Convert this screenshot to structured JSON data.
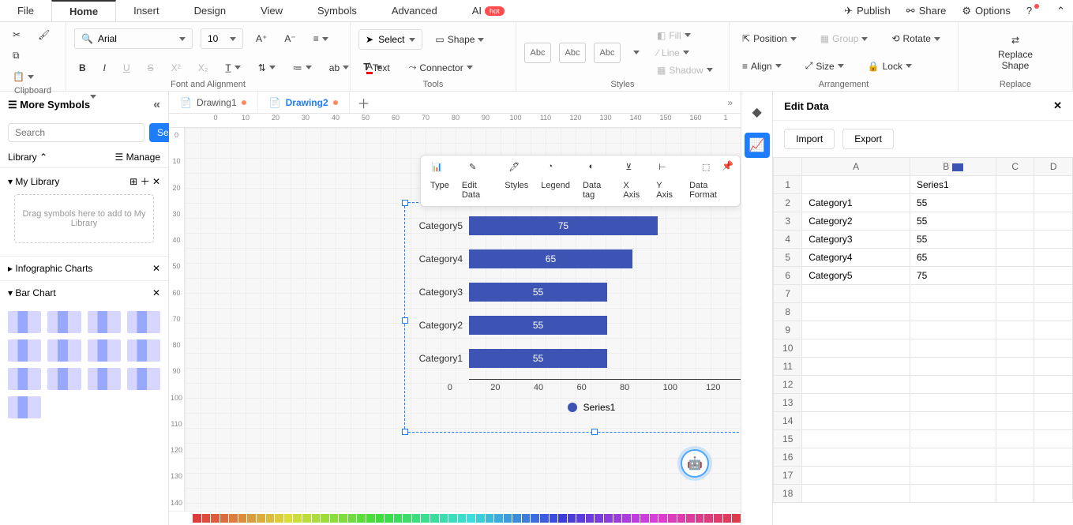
{
  "menu": {
    "file": "File",
    "home": "Home",
    "insert": "Insert",
    "design": "Design",
    "view": "View",
    "symbols": "Symbols",
    "advanced": "Advanced",
    "ai": "AI",
    "hot": "hot",
    "publish": "Publish",
    "share": "Share",
    "options": "Options"
  },
  "ribbon": {
    "clipboard": "Clipboard",
    "font_alignment": "Font and Alignment",
    "tools": "Tools",
    "styles": "Styles",
    "arrangement": "Arrangement",
    "replace": "Replace",
    "font_name": "Arial",
    "font_size": "10",
    "select": "Select",
    "shape": "Shape",
    "text": "Text",
    "connector": "Connector",
    "style_sample": "Abc",
    "fill": "Fill",
    "line": "Line",
    "shadow": "Shadow",
    "position": "Position",
    "align": "Align",
    "group": "Group",
    "size": "Size",
    "rotate": "Rotate",
    "lock": "Lock",
    "replace_shape": "Replace\nShape"
  },
  "left": {
    "more_symbols": "More Symbols",
    "search_ph": "Search",
    "search_btn": "Search",
    "library": "Library",
    "manage": "Manage",
    "my_library": "My Library",
    "drop_hint": "Drag symbols here to add to My Library",
    "infographic": "Infographic Charts",
    "bar_chart": "Bar Chart"
  },
  "docs": {
    "d1": "Drawing1",
    "d2": "Drawing2"
  },
  "float": {
    "type": "Type",
    "edit_data": "Edit Data",
    "styles": "Styles",
    "legend": "Legend",
    "data_tag": "Data tag",
    "xaxis": "X Axis",
    "yaxis": "Y Axis",
    "data_format": "Data Format"
  },
  "chart_data": {
    "type": "bar",
    "orientation": "horizontal",
    "categories": [
      "Category5",
      "Category4",
      "Category3",
      "Category2",
      "Category1"
    ],
    "series": [
      {
        "name": "Series1",
        "values": [
          75,
          65,
          55,
          55,
          55
        ]
      }
    ],
    "xlim": [
      0,
      120
    ],
    "xticks": [
      0,
      20,
      40,
      60,
      80,
      100,
      120
    ],
    "legend": "Series1",
    "bar_color": "#3d54b5"
  },
  "right": {
    "title": "Edit Data",
    "import": "Import",
    "export": "Export",
    "cols": [
      "A",
      "B",
      "C",
      "D"
    ],
    "rows": [
      {
        "n": "1",
        "a": "",
        "b": "Series1",
        "c": "",
        "d": ""
      },
      {
        "n": "2",
        "a": "Category1",
        "b": "55",
        "c": "",
        "d": ""
      },
      {
        "n": "3",
        "a": "Category2",
        "b": "55",
        "c": "",
        "d": ""
      },
      {
        "n": "4",
        "a": "Category3",
        "b": "55",
        "c": "",
        "d": ""
      },
      {
        "n": "5",
        "a": "Category4",
        "b": "65",
        "c": "",
        "d": ""
      },
      {
        "n": "6",
        "a": "Category5",
        "b": "75",
        "c": "",
        "d": ""
      },
      {
        "n": "7",
        "a": "",
        "b": "",
        "c": "",
        "d": ""
      },
      {
        "n": "8",
        "a": "",
        "b": "",
        "c": "",
        "d": ""
      },
      {
        "n": "9",
        "a": "",
        "b": "",
        "c": "",
        "d": ""
      },
      {
        "n": "10",
        "a": "",
        "b": "",
        "c": "",
        "d": ""
      },
      {
        "n": "11",
        "a": "",
        "b": "",
        "c": "",
        "d": ""
      },
      {
        "n": "12",
        "a": "",
        "b": "",
        "c": "",
        "d": ""
      },
      {
        "n": "13",
        "a": "",
        "b": "",
        "c": "",
        "d": ""
      },
      {
        "n": "14",
        "a": "",
        "b": "",
        "c": "",
        "d": ""
      },
      {
        "n": "15",
        "a": "",
        "b": "",
        "c": "",
        "d": ""
      },
      {
        "n": "16",
        "a": "",
        "b": "",
        "c": "",
        "d": ""
      },
      {
        "n": "17",
        "a": "",
        "b": "",
        "c": "",
        "d": ""
      },
      {
        "n": "18",
        "a": "",
        "b": "",
        "c": "",
        "d": ""
      }
    ]
  },
  "ruler_h": [
    "0",
    "10",
    "20",
    "30",
    "40",
    "50",
    "60",
    "70",
    "80",
    "90",
    "100",
    "110",
    "120",
    "130",
    "140",
    "150",
    "160",
    "1"
  ],
  "ruler_v": [
    "0",
    "10",
    "20",
    "30",
    "40",
    "50",
    "60",
    "70",
    "80",
    "90",
    "100",
    "110",
    "120",
    "130",
    "140"
  ]
}
